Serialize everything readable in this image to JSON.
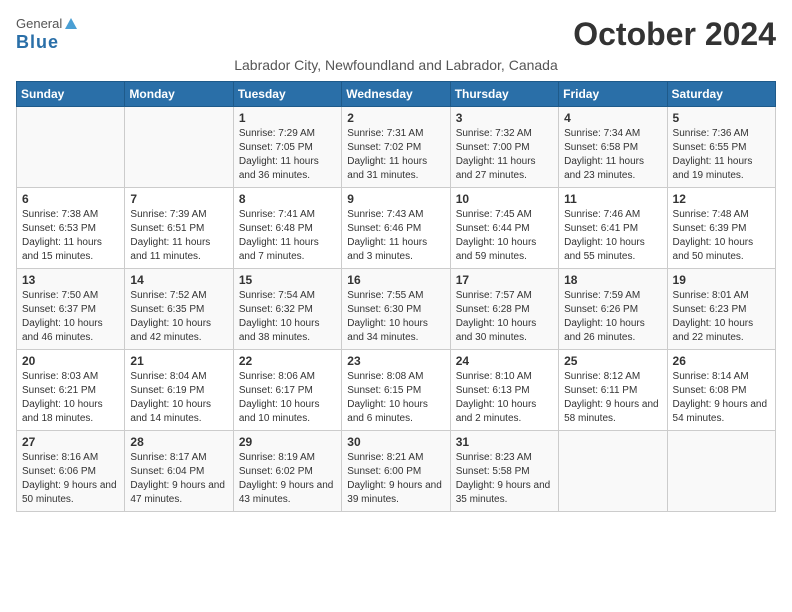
{
  "logo": {
    "general": "General",
    "blue": "Blue"
  },
  "title": "October 2024",
  "subtitle": "Labrador City, Newfoundland and Labrador, Canada",
  "days_header": [
    "Sunday",
    "Monday",
    "Tuesday",
    "Wednesday",
    "Thursday",
    "Friday",
    "Saturday"
  ],
  "weeks": [
    [
      {
        "day": "",
        "info": ""
      },
      {
        "day": "",
        "info": ""
      },
      {
        "day": "1",
        "info": "Sunrise: 7:29 AM\nSunset: 7:05 PM\nDaylight: 11 hours and 36 minutes."
      },
      {
        "day": "2",
        "info": "Sunrise: 7:31 AM\nSunset: 7:02 PM\nDaylight: 11 hours and 31 minutes."
      },
      {
        "day": "3",
        "info": "Sunrise: 7:32 AM\nSunset: 7:00 PM\nDaylight: 11 hours and 27 minutes."
      },
      {
        "day": "4",
        "info": "Sunrise: 7:34 AM\nSunset: 6:58 PM\nDaylight: 11 hours and 23 minutes."
      },
      {
        "day": "5",
        "info": "Sunrise: 7:36 AM\nSunset: 6:55 PM\nDaylight: 11 hours and 19 minutes."
      }
    ],
    [
      {
        "day": "6",
        "info": "Sunrise: 7:38 AM\nSunset: 6:53 PM\nDaylight: 11 hours and 15 minutes."
      },
      {
        "day": "7",
        "info": "Sunrise: 7:39 AM\nSunset: 6:51 PM\nDaylight: 11 hours and 11 minutes."
      },
      {
        "day": "8",
        "info": "Sunrise: 7:41 AM\nSunset: 6:48 PM\nDaylight: 11 hours and 7 minutes."
      },
      {
        "day": "9",
        "info": "Sunrise: 7:43 AM\nSunset: 6:46 PM\nDaylight: 11 hours and 3 minutes."
      },
      {
        "day": "10",
        "info": "Sunrise: 7:45 AM\nSunset: 6:44 PM\nDaylight: 10 hours and 59 minutes."
      },
      {
        "day": "11",
        "info": "Sunrise: 7:46 AM\nSunset: 6:41 PM\nDaylight: 10 hours and 55 minutes."
      },
      {
        "day": "12",
        "info": "Sunrise: 7:48 AM\nSunset: 6:39 PM\nDaylight: 10 hours and 50 minutes."
      }
    ],
    [
      {
        "day": "13",
        "info": "Sunrise: 7:50 AM\nSunset: 6:37 PM\nDaylight: 10 hours and 46 minutes."
      },
      {
        "day": "14",
        "info": "Sunrise: 7:52 AM\nSunset: 6:35 PM\nDaylight: 10 hours and 42 minutes."
      },
      {
        "day": "15",
        "info": "Sunrise: 7:54 AM\nSunset: 6:32 PM\nDaylight: 10 hours and 38 minutes."
      },
      {
        "day": "16",
        "info": "Sunrise: 7:55 AM\nSunset: 6:30 PM\nDaylight: 10 hours and 34 minutes."
      },
      {
        "day": "17",
        "info": "Sunrise: 7:57 AM\nSunset: 6:28 PM\nDaylight: 10 hours and 30 minutes."
      },
      {
        "day": "18",
        "info": "Sunrise: 7:59 AM\nSunset: 6:26 PM\nDaylight: 10 hours and 26 minutes."
      },
      {
        "day": "19",
        "info": "Sunrise: 8:01 AM\nSunset: 6:23 PM\nDaylight: 10 hours and 22 minutes."
      }
    ],
    [
      {
        "day": "20",
        "info": "Sunrise: 8:03 AM\nSunset: 6:21 PM\nDaylight: 10 hours and 18 minutes."
      },
      {
        "day": "21",
        "info": "Sunrise: 8:04 AM\nSunset: 6:19 PM\nDaylight: 10 hours and 14 minutes."
      },
      {
        "day": "22",
        "info": "Sunrise: 8:06 AM\nSunset: 6:17 PM\nDaylight: 10 hours and 10 minutes."
      },
      {
        "day": "23",
        "info": "Sunrise: 8:08 AM\nSunset: 6:15 PM\nDaylight: 10 hours and 6 minutes."
      },
      {
        "day": "24",
        "info": "Sunrise: 8:10 AM\nSunset: 6:13 PM\nDaylight: 10 hours and 2 minutes."
      },
      {
        "day": "25",
        "info": "Sunrise: 8:12 AM\nSunset: 6:11 PM\nDaylight: 9 hours and 58 minutes."
      },
      {
        "day": "26",
        "info": "Sunrise: 8:14 AM\nSunset: 6:08 PM\nDaylight: 9 hours and 54 minutes."
      }
    ],
    [
      {
        "day": "27",
        "info": "Sunrise: 8:16 AM\nSunset: 6:06 PM\nDaylight: 9 hours and 50 minutes."
      },
      {
        "day": "28",
        "info": "Sunrise: 8:17 AM\nSunset: 6:04 PM\nDaylight: 9 hours and 47 minutes."
      },
      {
        "day": "29",
        "info": "Sunrise: 8:19 AM\nSunset: 6:02 PM\nDaylight: 9 hours and 43 minutes."
      },
      {
        "day": "30",
        "info": "Sunrise: 8:21 AM\nSunset: 6:00 PM\nDaylight: 9 hours and 39 minutes."
      },
      {
        "day": "31",
        "info": "Sunrise: 8:23 AM\nSunset: 5:58 PM\nDaylight: 9 hours and 35 minutes."
      },
      {
        "day": "",
        "info": ""
      },
      {
        "day": "",
        "info": ""
      }
    ]
  ]
}
